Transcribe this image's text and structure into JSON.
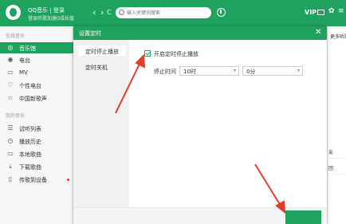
{
  "app": {
    "user_name": "QQ音乐 | 登录",
    "user_sub": "登录听歌加速0成长值",
    "nav_back": "‹",
    "nav_forward": "›",
    "refresh": "C",
    "search_placeholder": "输入关键词搜索",
    "top_right": {
      "vip": "VIP",
      "skin": "✿",
      "settings": "≡"
    }
  },
  "sidebar": {
    "section1": "在线音乐",
    "items1": [
      {
        "icon": "music-hall-icon",
        "glyph": "◎",
        "label": "音乐馆",
        "active": true
      },
      {
        "icon": "radio-icon",
        "glyph": "◉",
        "label": "电台",
        "active": false
      },
      {
        "icon": "mv-icon",
        "glyph": "▭",
        "label": "MV",
        "active": false
      },
      {
        "icon": "personal-radio-icon",
        "glyph": "♡",
        "label": "个性电台",
        "active": false
      },
      {
        "icon": "china-voice-icon",
        "glyph": "☆",
        "label": "中国新歌声",
        "active": false
      }
    ],
    "section2": "我的音乐",
    "items2": [
      {
        "icon": "trial-list-icon",
        "glyph": "☰",
        "label": "试听列表"
      },
      {
        "icon": "history-icon",
        "glyph": "◷",
        "label": "播放历史"
      },
      {
        "icon": "local-songs-icon",
        "glyph": "▭",
        "label": "本地歌曲"
      },
      {
        "icon": "download-icon",
        "glyph": "⤓",
        "label": "下载歌曲"
      },
      {
        "icon": "device-icon",
        "glyph": "▯",
        "label": "传歌到设备"
      }
    ]
  },
  "background": {
    "fragment_top": "更多听歌姿",
    "fragment_mid": "友",
    "fragment_mid2": "团"
  },
  "dialog": {
    "title": "设置定时",
    "close": "✕",
    "tabs": [
      "定时停止播放",
      "定时关机"
    ],
    "checkbox_label": "开启定时停止播放",
    "checked": true,
    "stop_time_label": "停止时间",
    "hour_value": "10时",
    "minute_value": "0分",
    "dropdown_arrow": "▾"
  },
  "colors": {
    "accent": "#1fa25e",
    "arrow": "#e33c2b"
  }
}
